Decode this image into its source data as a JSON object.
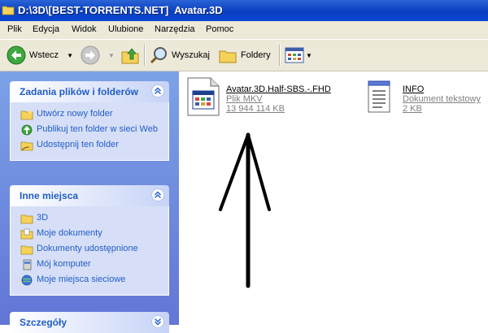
{
  "window": {
    "title": "D:\\3D\\[BEST-TORRENTS.NET]  Avatar.3D"
  },
  "menu": [
    "Plik",
    "Edycja",
    "Widok",
    "Ulubione",
    "Narzędzia",
    "Pomoc"
  ],
  "toolbar": {
    "back_label": "Wstecz",
    "search_label": "Wyszukaj",
    "folders_label": "Foldery"
  },
  "sidebar": {
    "tasks": {
      "title": "Zadania plików i folderów",
      "items": [
        "Utwórz nowy folder",
        "Publikuj ten folder w sieci Web",
        "Udostępnij ten folder"
      ]
    },
    "places": {
      "title": "Inne miejsca",
      "items": [
        "3D",
        "Moje dokumenty",
        "Dokumenty udostępnione",
        "Mój komputer",
        "Moje miejsca sieciowe"
      ]
    },
    "details": {
      "title": "Szczegóły"
    }
  },
  "files": [
    {
      "name": "Avatar.3D.Half-SBS.-.FHD",
      "type": "Plik MKV",
      "size": "13 944 114 KB",
      "icon": "mkv-file-icon"
    },
    {
      "name": "INFO",
      "type": "Dokument tekstowy",
      "size": "2 KB",
      "icon": "text-file-icon"
    }
  ],
  "colors": {
    "title_bar": "#0a3fc0",
    "sidebar_bg": "#6e8fe0",
    "link_blue": "#215dc6"
  }
}
